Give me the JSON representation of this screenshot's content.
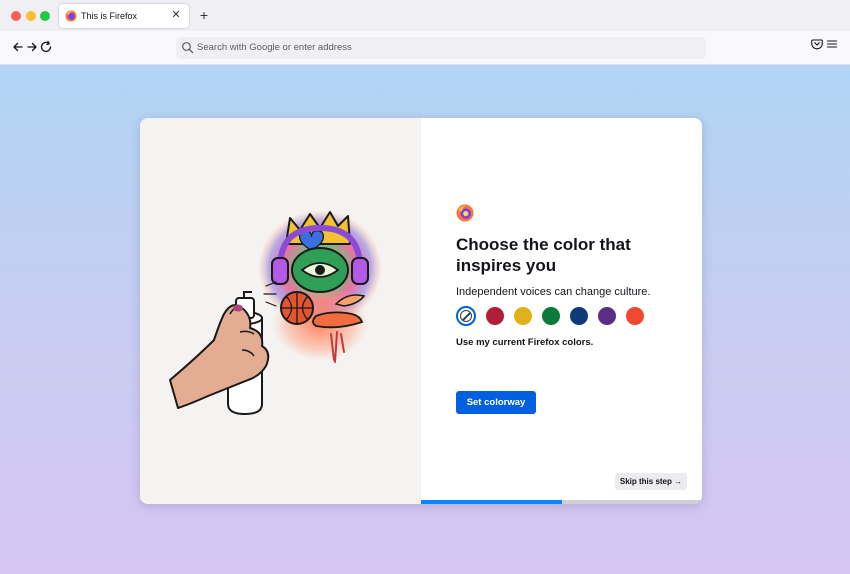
{
  "browser": {
    "tab_title": "This is Firefox",
    "url_placeholder": "Search with Google or enter address"
  },
  "icons": {
    "back": "arrow-left-icon",
    "forward": "arrow-right-icon",
    "reload": "reload-icon",
    "search": "search-icon",
    "pocket": "pocket-icon",
    "menu": "hamburger-menu-icon",
    "close": "close-icon",
    "new_tab": "plus-icon",
    "logo": "firefox-logo-icon"
  },
  "onboarding": {
    "heading": "Choose the color that inspires you",
    "subheading": "Independent voices can change culture.",
    "colors_label": "Use my current Firefox colors.",
    "primary_button": "Set colorway",
    "skip_button": "Skip this step →",
    "progress": 0.5,
    "colorways": [
      {
        "name": "current",
        "color": "#ffffff",
        "selected": true
      },
      {
        "name": "red",
        "color": "#b01e38",
        "selected": false
      },
      {
        "name": "yellow",
        "color": "#e0b11a",
        "selected": false
      },
      {
        "name": "green",
        "color": "#0b7a3b",
        "selected": false
      },
      {
        "name": "navy",
        "color": "#0f3a78",
        "selected": false
      },
      {
        "name": "purple",
        "color": "#5a2d86",
        "selected": false
      },
      {
        "name": "orange-red",
        "color": "#ef4a2f",
        "selected": false
      }
    ]
  },
  "colors": {
    "accent": "#0060df",
    "progress": "#0a84ff"
  }
}
